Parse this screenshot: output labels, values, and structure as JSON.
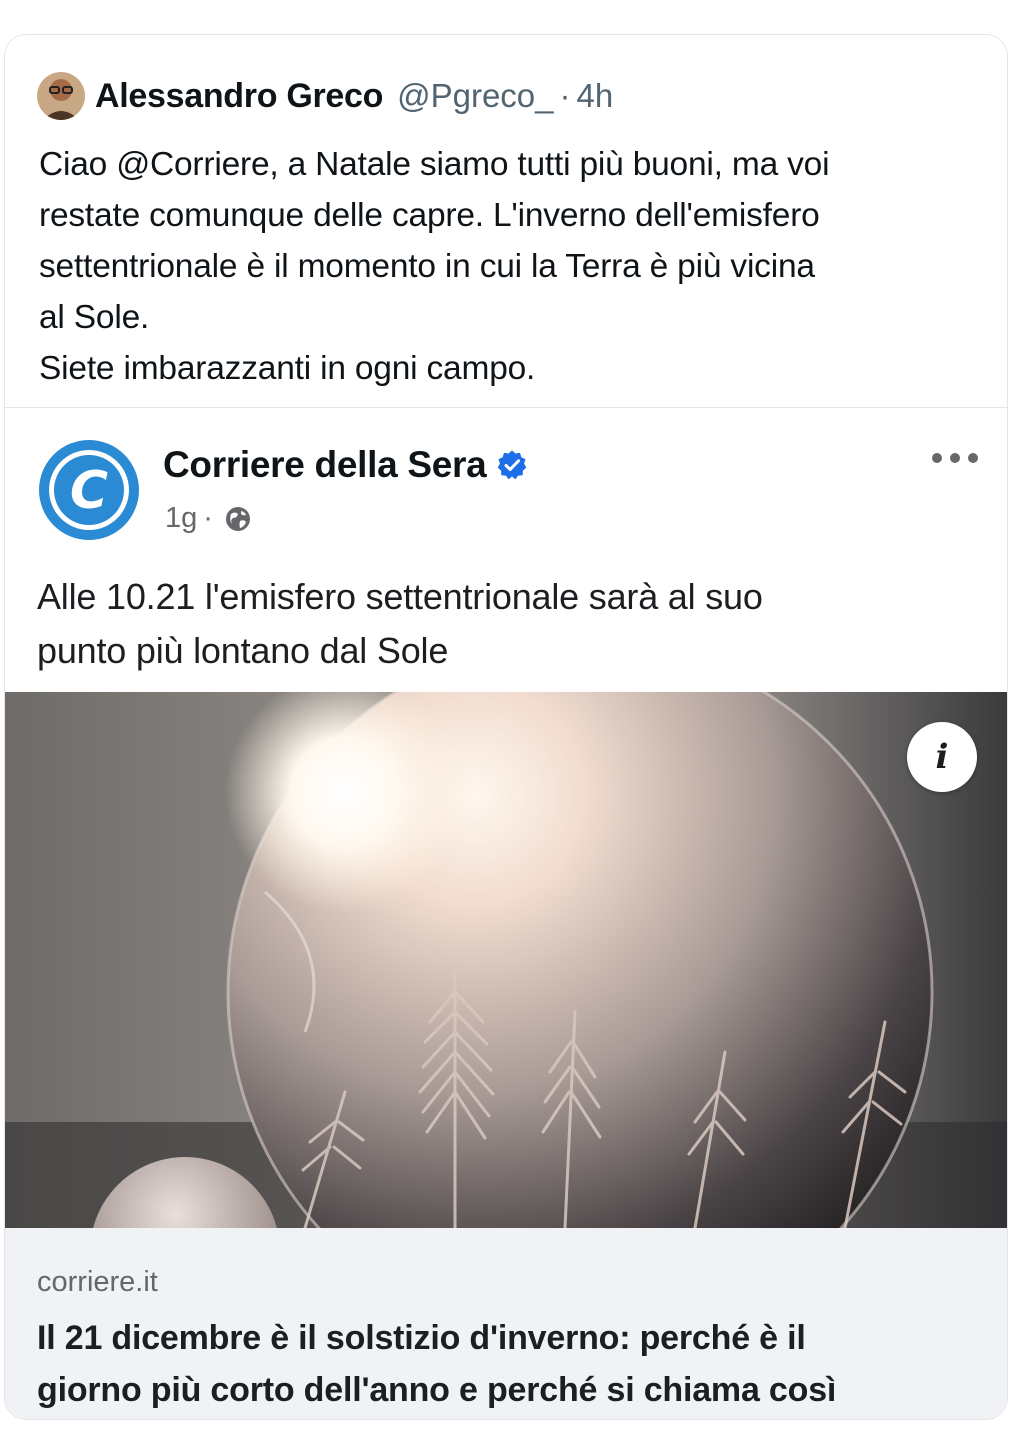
{
  "tweet": {
    "author_name": "Alessandro Greco",
    "handle": "@Pgreco_",
    "separator": "·",
    "time": "4h",
    "text_lines": [
      "Ciao @Corriere, a Natale siamo tutti più buoni, ma voi",
      "restate comunque delle capre. L'inverno dell'emisfero",
      "settentrionale è il momento in cui la Terra è più vicina",
      "al Sole.",
      "Siete imbarazzanti in ogni campo."
    ]
  },
  "embed": {
    "page_name": "Corriere della Sera",
    "logo_letter": "C",
    "verified_icon": "verified-badge-icon",
    "age": "1g",
    "separator": "·",
    "audience_icon": "globe-icon",
    "more_icon": "more-horizontal-icon",
    "text_lines": [
      "Alle 10.21 l'emisfero settentrionale sarà al suo",
      "punto più lontano dal Sole"
    ],
    "image_info_label": "i",
    "link": {
      "domain": "corriere.it",
      "title_lines": [
        "Il 21 dicembre è il solstizio d'inverno: perché è il",
        "giorno più corto dell'anno e perché si chiama così"
      ]
    }
  },
  "colors": {
    "brand_blue": "#2a8ad4",
    "verified_blue": "#1d6fe8",
    "secondary_text": "#536471",
    "link_bg": "#f0f2f5"
  }
}
